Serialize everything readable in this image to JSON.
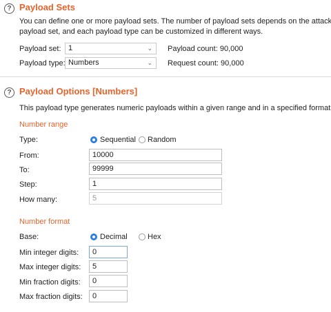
{
  "payload_sets": {
    "title": "Payload Sets",
    "description_line1": "You can define one or more payload sets. The number of payload sets depends on the attack typ",
    "description_line2": "payload set, and each payload type can be customized in different ways.",
    "payload_set_label": "Payload set:",
    "payload_set_value": "1",
    "payload_type_label": "Payload type:",
    "payload_type_value": "Numbers",
    "payload_count": "Payload count: 90,000",
    "request_count": "Request count: 90,000"
  },
  "payload_options": {
    "title": "Payload Options [Numbers]",
    "description": "This payload type generates numeric payloads within a given range and in a specified format.",
    "number_range": {
      "heading": "Number range",
      "type_label": "Type:",
      "type_options": [
        "Sequential",
        "Random"
      ],
      "type_selected": "Sequential",
      "from_label": "From:",
      "from_value": "10000",
      "to_label": "To:",
      "to_value": "99999",
      "step_label": "Step:",
      "step_value": "1",
      "how_many_label": "How many:",
      "how_many_value": "5"
    },
    "number_format": {
      "heading": "Number format",
      "base_label": "Base:",
      "base_options": [
        "Decimal",
        "Hex"
      ],
      "base_selected": "Decimal",
      "min_integer_label": "Min integer digits:",
      "min_integer_value": "0",
      "max_integer_label": "Max integer digits:",
      "max_integer_value": "5",
      "min_fraction_label": "Min fraction digits:",
      "min_fraction_value": "0",
      "max_fraction_label": "Max fraction digits:",
      "max_fraction_value": "0"
    }
  },
  "colors": {
    "accent": "#e8622a",
    "radio_selected": "#2f7fdc"
  }
}
